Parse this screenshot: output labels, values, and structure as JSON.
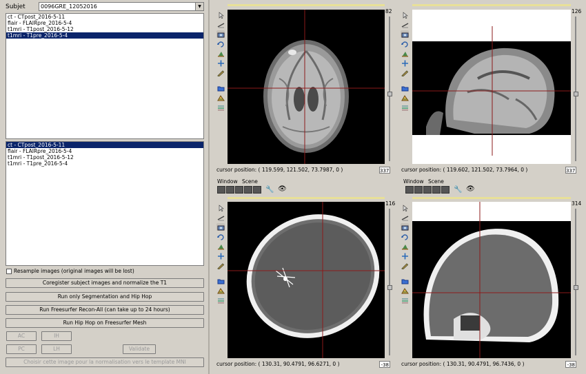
{
  "left": {
    "subject_label": "Subjet",
    "subject_value": "0096GRE_12052016",
    "list1": [
      {
        "text": "ct - CTpost_2016-5-11",
        "selected": false
      },
      {
        "text": "flair - FLAIRpre_2016-5-4",
        "selected": false
      },
      {
        "text": "t1mri - T1post_2016-5-12",
        "selected": false
      },
      {
        "text": "t1mri - T1pre_2016-5-4",
        "selected": true
      }
    ],
    "list2": [
      {
        "text": "ct - CTpost_2016-5-11",
        "selected": true
      },
      {
        "text": "flair - FLAIRpre_2016-5-4",
        "selected": false
      },
      {
        "text": "t1mri - T1post_2016-5-12",
        "selected": false
      },
      {
        "text": "t1mri - T1pre_2016-5-4",
        "selected": false
      }
    ],
    "resample_label": "Resample images (original images will be lost)",
    "buttons": {
      "coregister": "Coregister subject images and normalize the T1",
      "segmentation": "Run only Segmentation and Hip Hop",
      "freesurfer": "Run Freesurfer Recon-All (can take up to 24 hours)",
      "hiphop": "Run Hip Hop on Freesurfer Mesh",
      "ac": "AC",
      "ih": "IH",
      "pc": "PC",
      "lh": "LH",
      "validate": "Validate",
      "mni": "Choisir cette image pour la normalisation vers le template MNI"
    }
  },
  "menu": {
    "window": "Window",
    "scene": "Scene"
  },
  "viewers": [
    {
      "top_value": "82",
      "cursor": "cursor position: ( 119.599, 121.502, 73.7987, 0 )",
      "slice": "337"
    },
    {
      "top_value": "126",
      "cursor": "cursor position: ( 119.602, 121.502, 73.7964, 0 )",
      "slice": "337"
    },
    {
      "top_value": "116",
      "cursor": "cursor position: ( 130.31, 90.4791, 96.6271, 0 )",
      "slice": "-38"
    },
    {
      "top_value": "314",
      "cursor": "cursor position: ( 130.31, 90.4791, 96.7436, 0 )",
      "slice": "-38"
    }
  ],
  "icons": {
    "toolbar": [
      "pointer-icon",
      "ruler-icon",
      "camera-icon",
      "rotate-icon",
      "zoom-icon",
      "crosshair-icon",
      "pencil-icon",
      "folder-icon",
      "palette-icon",
      "layers-icon"
    ]
  },
  "colors": {
    "selection": "#0a246a",
    "crosshair": "#8b1a1a",
    "panel": "#d4d0c8"
  }
}
